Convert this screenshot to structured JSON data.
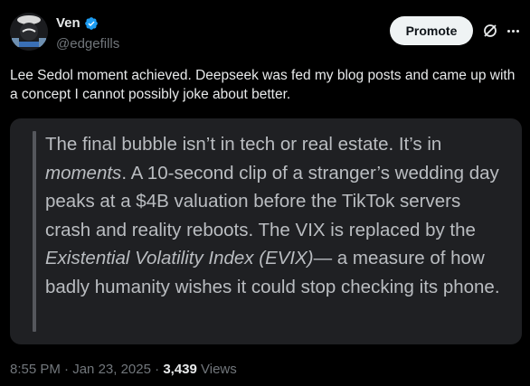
{
  "author": {
    "display_name": "Ven",
    "handle": "@edgefills",
    "verified": true
  },
  "actions": {
    "promote_label": "Promote",
    "grok_icon": "grok-icon",
    "more_icon": "more-icon"
  },
  "tweet": {
    "text": "Lee Sedol moment achieved. Deepseek was fed my blog posts and came up with a concept I cannot possibly joke about better."
  },
  "quote": {
    "part1": "The final bubble isn’t in tech or real estate. It’s in ",
    "italic1": "moments",
    "part2": ". A 10-second clip of a stranger’s wedding day peaks at a $4B valuation before the TikTok servers crash and reality reboots. The VIX is replaced by the ",
    "italic2": "Existential Volatility Index (EVIX)",
    "part3": "— a measure of how badly humanity wishes it could stop checking its phone."
  },
  "meta": {
    "time": "8:55 PM",
    "sep1": " · ",
    "date": "Jan 23, 2025",
    "sep2": " · ",
    "views_count": "3,439",
    "views_label": " Views"
  },
  "colors": {
    "background": "#000000",
    "text_primary": "#e7e9ea",
    "text_secondary": "#71767b",
    "verified_badge": "#1d9bf0",
    "quote_bg": "#1f2023",
    "quote_text": "#babdc1"
  }
}
